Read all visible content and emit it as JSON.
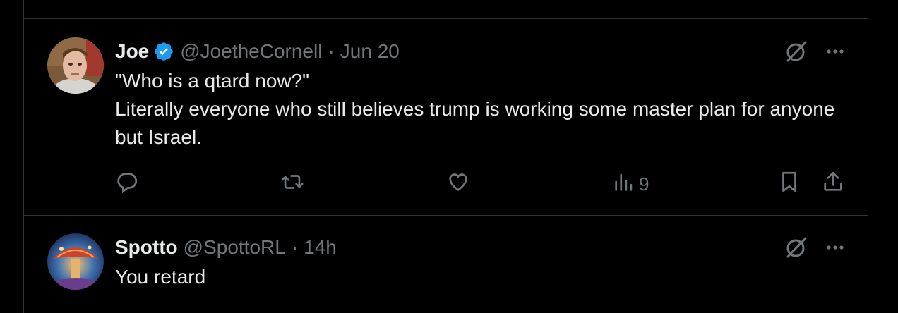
{
  "posts": [
    {
      "author_name": "Joe",
      "verified": true,
      "handle": "@JoetheCornell",
      "separator": "·",
      "time": "Jun 20",
      "text_line1": "\"Who is a qtard now?\"",
      "text_line2": "Literally everyone who still believes trump is working some master plan for anyone but Israel.",
      "views": "9"
    },
    {
      "author_name": "Spotto",
      "verified": false,
      "handle": "@SpottoRL",
      "separator": "·",
      "time": "14h",
      "text_line1": "You retard"
    }
  ],
  "icons": {
    "reply": "reply-icon",
    "repost": "repost-icon",
    "like": "heart-icon",
    "views": "views-icon",
    "bookmark": "bookmark-icon",
    "share": "share-icon",
    "grok": "grok-icon",
    "more": "more-icon",
    "verified": "verified-badge-icon"
  },
  "colors": {
    "background": "#000000",
    "text": "#e7e9ea",
    "muted": "#71767b",
    "border": "#2f3336",
    "verified_blue": "#1d9bf0"
  }
}
